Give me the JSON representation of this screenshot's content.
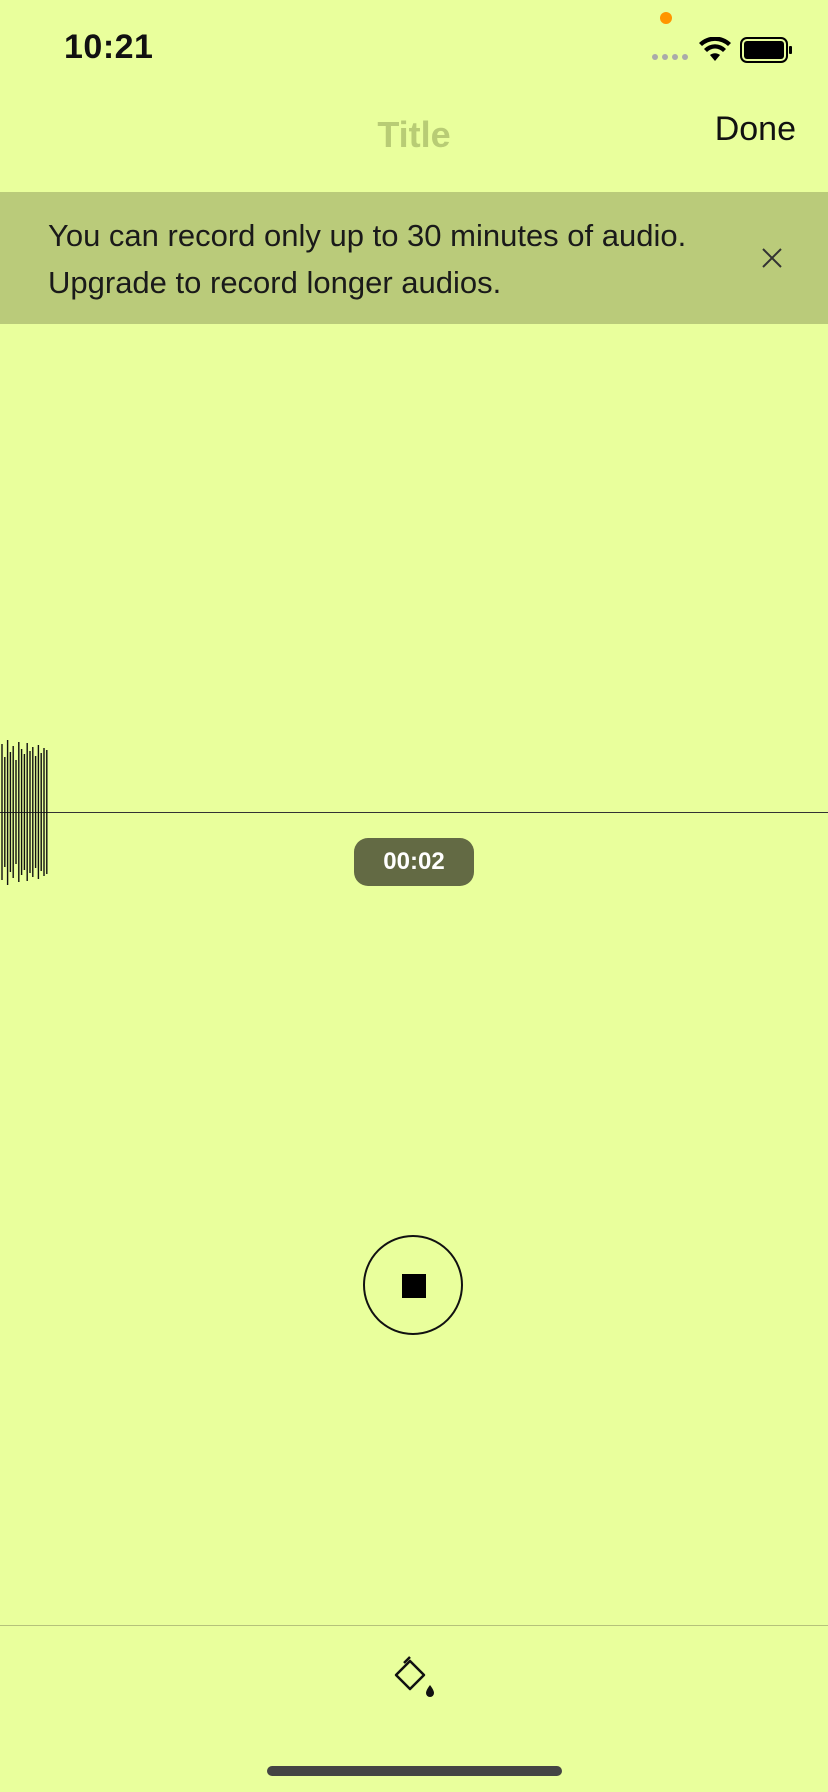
{
  "status_bar": {
    "time": "10:21"
  },
  "nav": {
    "title": "Title",
    "done_label": "Done"
  },
  "banner": {
    "message": "You can record only up to 30 minutes of audio. Upgrade to record longer audios."
  },
  "recorder": {
    "elapsed": "00:02"
  },
  "icons": {
    "banner_close": "close-icon",
    "record_control": "stop-icon",
    "toolbar": "paint-bucket-icon"
  },
  "colors": {
    "background": "#e9ff9c",
    "banner": "#bacb7a",
    "timer_pill": "#636a44",
    "mic_indicator": "#ff9500"
  }
}
